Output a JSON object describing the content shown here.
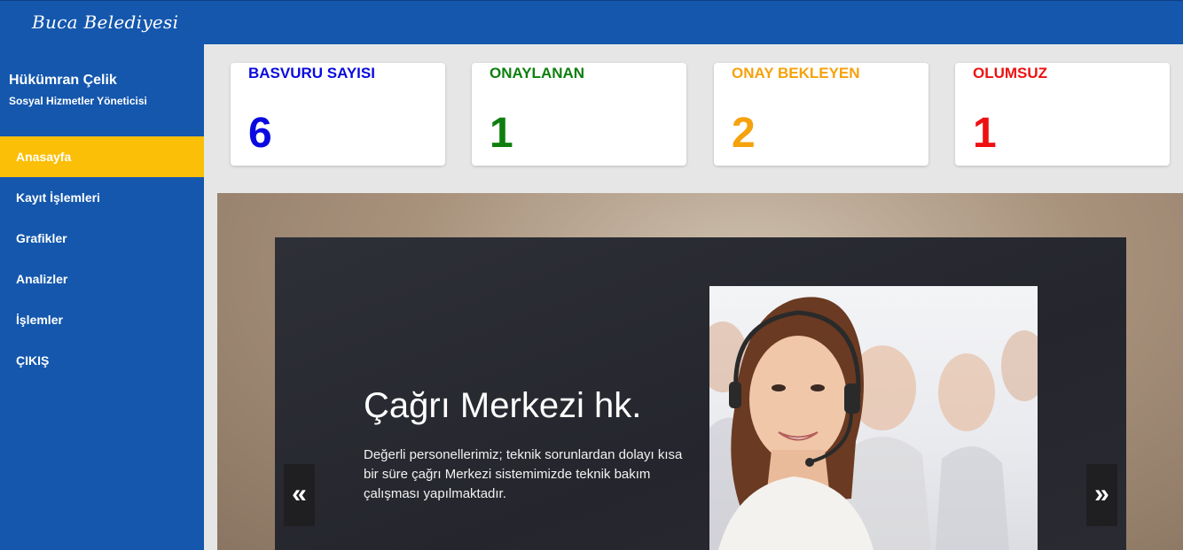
{
  "header": {
    "brand": "Buca Belediyesi"
  },
  "sidebar": {
    "user_name": "Hükümran Çelik",
    "user_role": "Sosyal Hizmetler Yöneticisi",
    "items": [
      {
        "label": "Anasayfa",
        "active": true
      },
      {
        "label": "Kayıt İşlemleri"
      },
      {
        "label": "Grafikler"
      },
      {
        "label": "Analizler"
      },
      {
        "label": "İşlemler"
      },
      {
        "label": "ÇIKIŞ"
      }
    ]
  },
  "stats": [
    {
      "label": "BASVURU SAYISI",
      "value": "6",
      "color": "#0a0ae0"
    },
    {
      "label": "ONAYLANAN",
      "value": "1",
      "color": "#0e7f0e"
    },
    {
      "label": "ONAY BEKLEYEN",
      "value": "2",
      "color": "#f5a20c"
    },
    {
      "label": "OLUMSUZ",
      "value": "1",
      "color": "#ee1111"
    }
  ],
  "carousel": {
    "title": "Çağrı Merkezi hk.",
    "text": "Değerli personellerimiz; teknik sorunlardan dolayı kısa bir süre çağrı Merkezi sistemimizde teknik bakım çalışması yapılmaktadır.",
    "prev_label": "«",
    "next_label": "»"
  },
  "colors": {
    "primary": "#1457ad",
    "active_menu": "#fbbf08"
  }
}
